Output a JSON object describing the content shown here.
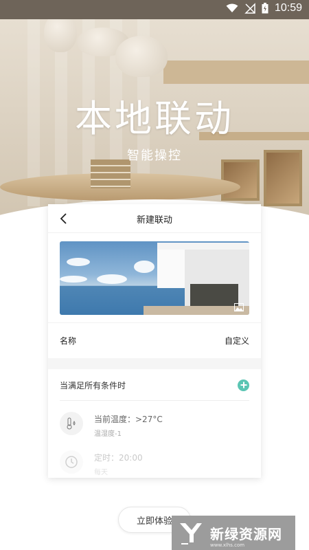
{
  "status_bar": {
    "time": "10:59"
  },
  "hero": {
    "title": "本地联动",
    "subtitle": "智能操控"
  },
  "card": {
    "title": "新建联动",
    "name_row": {
      "label": "名称",
      "value": "自定义"
    },
    "conditions": {
      "title": "当满足所有条件时",
      "items": [
        {
          "label": "当前温度：>27°C",
          "sub": "温湿度-1",
          "icon": "thermometer-icon"
        },
        {
          "label": "定时：20:00",
          "sub": "每天",
          "icon": "clock-icon"
        }
      ]
    }
  },
  "cta": {
    "label": "立即体验"
  },
  "watermark": {
    "text": "新绿资源网",
    "url": "www.xlhs.com"
  },
  "colors": {
    "accent": "#5bc5b3",
    "status_bar": "#6e6459"
  }
}
